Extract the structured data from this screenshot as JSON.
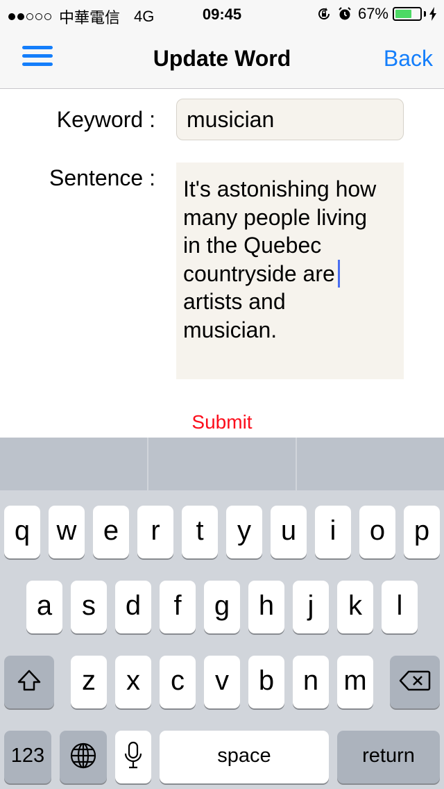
{
  "status_bar": {
    "carrier": "中華電信",
    "network": "4G",
    "time": "09:45",
    "battery_percent": "67%",
    "battery_level": 0.67,
    "signal_bars_filled": 2,
    "signal_bars_total": 5,
    "icons": [
      "signal-dots-icon",
      "rotation-lock-icon",
      "alarm-icon",
      "battery-icon",
      "charging-bolt-icon"
    ]
  },
  "nav": {
    "title": "Update Word",
    "back_label": "Back",
    "menu_icon": "hamburger-menu-icon",
    "accent_color": "#147efb"
  },
  "form": {
    "keyword_label": "Keyword :",
    "keyword_value": "musician",
    "sentence_label": "Sentence :",
    "sentence_lines": [
      "It's astonishing how",
      "many people living",
      "in the Quebec",
      "countryside are",
      "artists and",
      "musician."
    ],
    "submit_label": "Submit",
    "submit_color": "#fc0d1b"
  },
  "keyboard": {
    "row1": [
      "q",
      "w",
      "e",
      "r",
      "t",
      "y",
      "u",
      "i",
      "o",
      "p"
    ],
    "row2": [
      "a",
      "s",
      "d",
      "f",
      "g",
      "h",
      "j",
      "k",
      "l"
    ],
    "row3": [
      "z",
      "x",
      "c",
      "v",
      "b",
      "n",
      "m"
    ],
    "numbers_label": "123",
    "space_label": "space",
    "return_label": "return",
    "icons": [
      "shift-icon",
      "delete-icon",
      "globe-icon",
      "microphone-icon"
    ]
  }
}
